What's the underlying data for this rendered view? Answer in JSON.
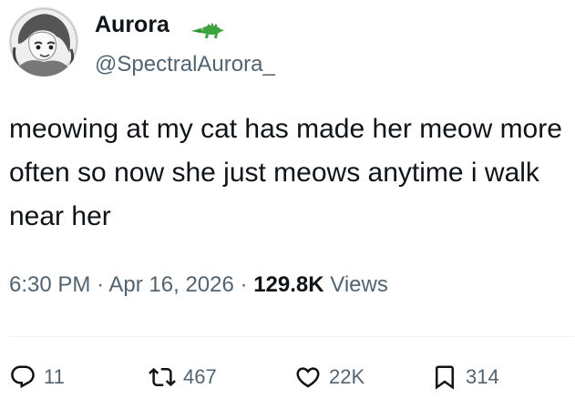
{
  "author": {
    "name": "Aurora",
    "handle": "@SpectralAurora_",
    "badge_icon": "crocodile-emoji-icon"
  },
  "tweet": {
    "text": "meowing at my cat has made her meow more often so now she just meows anytime i walk near her"
  },
  "meta": {
    "time": "6:30 PM",
    "separator": "·",
    "date": "Apr 16, 2026",
    "views_count": "129.8K",
    "views_label": "Views"
  },
  "actions": {
    "replies": "11",
    "retweets": "467",
    "likes": "22K",
    "bookmarks": "314"
  },
  "colors": {
    "text_primary": "#0f1419",
    "text_secondary": "#536471",
    "divider": "#eff3f4",
    "croc_green": "#3aa53a"
  }
}
